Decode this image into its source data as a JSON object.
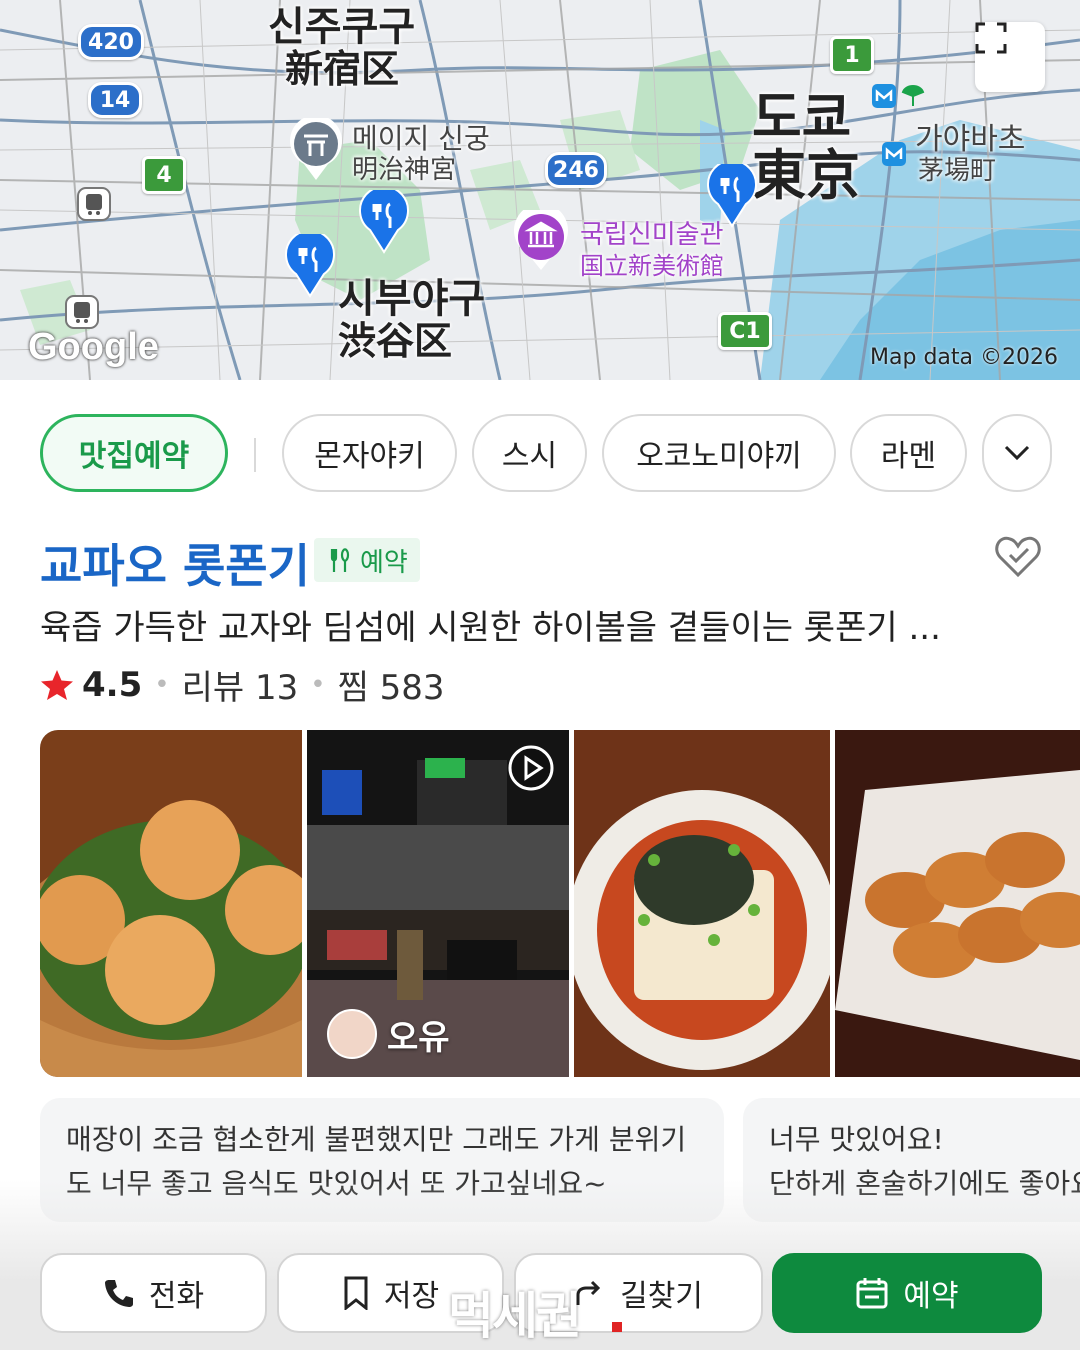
{
  "map": {
    "labels": {
      "shinjuku_ko": "신주쿠구",
      "shinjuku_ja": "新宿区",
      "meiji_ko": "메이지 신궁",
      "meiji_ja": "明治神宮",
      "tokyo_ko": "도쿄",
      "tokyo_ja": "東京",
      "kayabacho_ko": "가야바초",
      "kayabacho_ja": "茅場町",
      "nact_ko": "국립신미술관",
      "nact_ja": "国立新美術館",
      "shibuya_ko": "시부야구",
      "shibuya_ja": "渋谷区"
    },
    "routes": {
      "r420": "420",
      "r14": "14",
      "r4": "4",
      "r246": "246",
      "r1": "1",
      "rc1": "C1"
    },
    "google_logo": "Google",
    "attribution": "Map data ©2026",
    "expand_icon": "expand-icon"
  },
  "chips": {
    "active": "맛집예약",
    "items": [
      "몬자야키",
      "스시",
      "오코노미야끼",
      "라멘"
    ],
    "more_icon": "chevron-down-icon"
  },
  "place": {
    "name": "교파오 롯폰기",
    "badge": "예약",
    "description": "육즙 가득한 교자와 딤섬에 시원한 하이볼을 곁들이는 롯폰기 ...",
    "rating": "4.5",
    "reviews": "리뷰 13",
    "saves": "찜 583"
  },
  "photos": {
    "user_name": "오유"
  },
  "reviews": [
    {
      "line1": "매장이 조금 협소한게 불편했지만 그래도 가게 분위기",
      "line2": "도 너무 좋고 음식도 맛있어서 또 가고싶네요~"
    },
    {
      "line1": "너무 맛있어요!",
      "line2": "단하게 혼술하기에도 좋아요."
    }
  ],
  "actions": {
    "call": "전화",
    "save": "저장",
    "directions": "길찾기",
    "reserve": "예약"
  },
  "watermark": "먹세권",
  "colors": {
    "accent_green": "#0e8a3e",
    "title_blue": "#1a66c6",
    "chip_green": "#2db45d"
  }
}
